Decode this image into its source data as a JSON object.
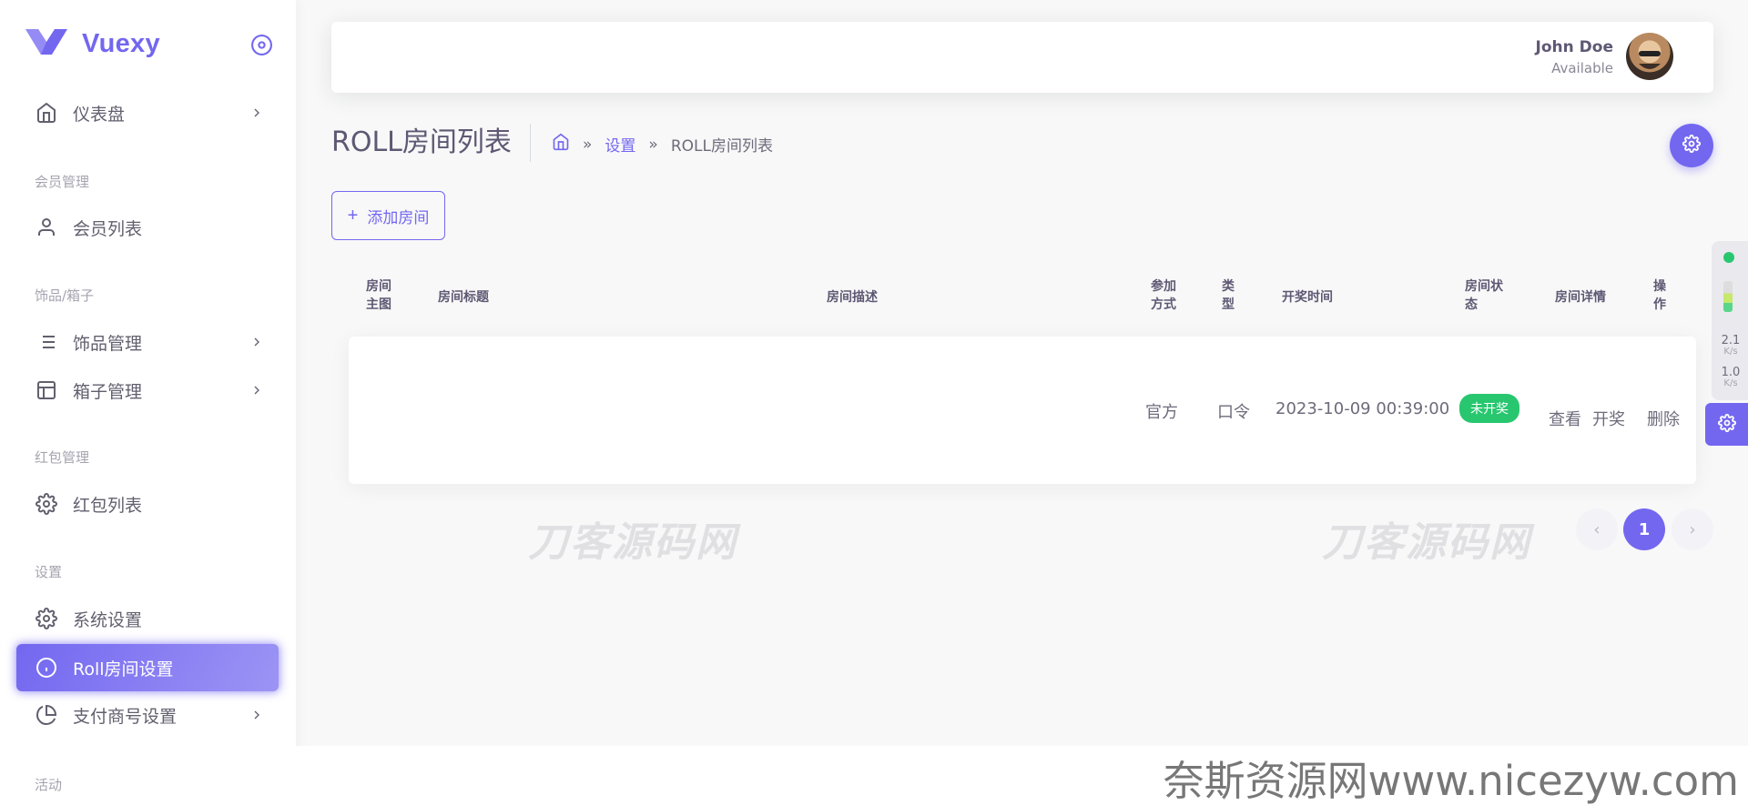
{
  "app": {
    "brand": "Vuexy"
  },
  "sidebar": {
    "items": [
      {
        "label": "仪表盘",
        "icon": "home-icon",
        "has_chevron": true
      },
      {
        "header": "会员管理"
      },
      {
        "label": "会员列表",
        "icon": "user-icon",
        "has_chevron": false
      },
      {
        "header": "饰品/箱子"
      },
      {
        "label": "饰品管理",
        "icon": "list-icon",
        "has_chevron": true
      },
      {
        "label": "箱子管理",
        "icon": "layout-icon",
        "has_chevron": true
      },
      {
        "header": "红包管理"
      },
      {
        "label": "红包列表",
        "icon": "gear-icon",
        "has_chevron": false
      },
      {
        "header": "设置"
      },
      {
        "label": "系统设置",
        "icon": "gear-icon",
        "has_chevron": false
      },
      {
        "label": "Roll房间设置",
        "icon": "info-icon",
        "active": true
      },
      {
        "label": "支付商号设置",
        "icon": "pie-chart-icon",
        "has_chevron": true
      },
      {
        "header": "活动"
      }
    ]
  },
  "header": {
    "user_name": "John Doe",
    "user_status": "Available"
  },
  "page": {
    "title": "ROLL房间列表",
    "breadcrumb": [
      "设置",
      "ROLL房间列表"
    ],
    "add_button": "添加房间"
  },
  "table": {
    "columns": [
      {
        "line1": "房间",
        "line2": "主图"
      },
      {
        "line1": "房间标题",
        "line2": ""
      },
      {
        "line1": "房间描述",
        "line2": ""
      },
      {
        "line1": "参加",
        "line2": "方式"
      },
      {
        "line1": "类",
        "line2": "型"
      },
      {
        "line1": "开奖时间",
        "line2": ""
      },
      {
        "line1": "房间状",
        "line2": "态"
      },
      {
        "line1": "房间详情",
        "line2": ""
      },
      {
        "line1": "操",
        "line2": "作"
      }
    ],
    "rows": [
      {
        "join_method": "官方",
        "type": "口令",
        "draw_time": "2023-10-09 00:39:00",
        "status": "未开奖",
        "action_view": "查看",
        "action_draw": "开奖",
        "action_delete": "删除"
      }
    ]
  },
  "pagination": {
    "current": "1",
    "prev": "‹",
    "next": "›"
  },
  "widget": {
    "upload_speed": "2.1",
    "download_speed": "1.0",
    "unit": "K/s"
  },
  "watermarks": {
    "center": "刀客源码网",
    "footer": "奈斯资源网www.nicezyw.com"
  },
  "colors": {
    "primary": "#7367f0",
    "success": "#28c76f",
    "text": "#6e6b7b",
    "heading": "#5e5873"
  }
}
